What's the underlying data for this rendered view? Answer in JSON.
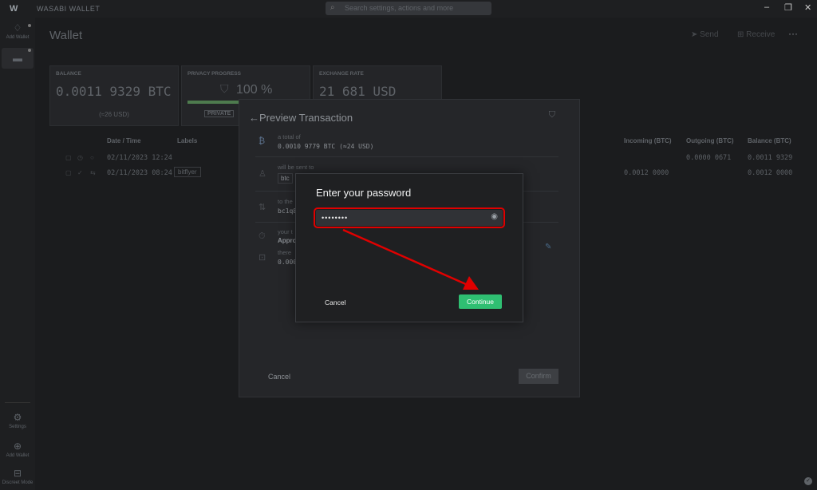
{
  "app": {
    "logo": "W",
    "title": "WASABI WALLET",
    "search_placeholder": "Search settings, actions and more",
    "window_controls": {
      "minimize": "–",
      "restore": "❐",
      "close": "✕"
    }
  },
  "sidebar": {
    "top_items": [
      {
        "label": "Add Wallet",
        "icon": "wallet-add-icon"
      },
      {
        "label": "",
        "icon": "wallet-icon"
      }
    ],
    "bottom_items": [
      {
        "label": "Settings",
        "icon": "gear-icon"
      },
      {
        "label": "Add Wallet",
        "icon": "plus-icon"
      },
      {
        "label": "Discreet Mode",
        "icon": "eye-icon"
      }
    ]
  },
  "wallet": {
    "title": "Wallet",
    "actions": {
      "send": "Send",
      "receive": "Receive",
      "more": "···"
    }
  },
  "tiles": {
    "balance": {
      "head": "BALANCE",
      "value": "0.0011 9329 BTC",
      "sub": "(≈26 USD)"
    },
    "privacy": {
      "head": "PRIVACY PROGRESS",
      "value": "100 %",
      "progress": 1.0,
      "badge": "PRIVATE"
    },
    "exchange": {
      "head": "EXCHANGE RATE",
      "value": "21 681 USD"
    }
  },
  "history": {
    "columns": {
      "date": "Date / Time",
      "labels": "Labels",
      "incoming": "Incoming (BTC)",
      "outgoing": "Outgoing (BTC)",
      "balance": "Balance (BTC)"
    },
    "rows": [
      {
        "date": "02/11/2023 12:24",
        "label": "",
        "incoming": "",
        "outgoing": "0.0000 0671",
        "balance": "0.0011 9329"
      },
      {
        "date": "02/11/2023 08:24",
        "label": "bitflyer",
        "incoming": "0.0012 0000",
        "outgoing": "",
        "balance": "0.0012 0000"
      }
    ]
  },
  "preview": {
    "title": "Preview Transaction",
    "total_caption": "a total of",
    "total_value": "0.0010 9779 BTC (≈24 USD)",
    "sent_to_caption": "will be sent to",
    "sent_to_chip": "btc",
    "address_caption": "to the",
    "address_value": "bc1q8",
    "time_caption": "your t",
    "time_value": "Approx",
    "fee_caption": "there",
    "fee_value": "0.000",
    "cancel": "Cancel",
    "confirm": "Confirm"
  },
  "password_dialog": {
    "title": "Enter your password",
    "value": "••••••••",
    "cancel": "Cancel",
    "continue": "Continue"
  },
  "colors": {
    "accent_green": "#2fbf72",
    "highlight_red": "#e00000"
  }
}
